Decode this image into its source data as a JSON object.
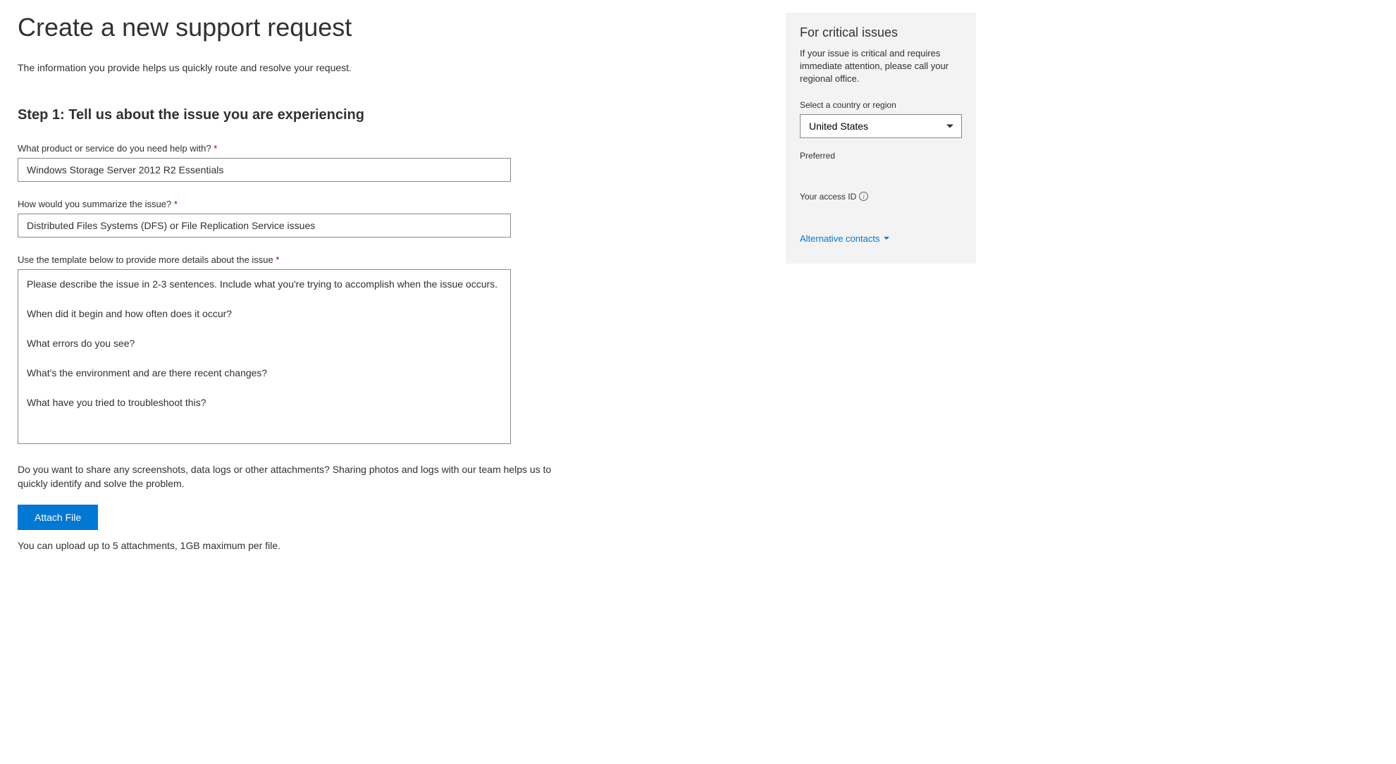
{
  "page": {
    "title": "Create a new support request",
    "subtitle": "The information you provide helps us quickly route and resolve your request."
  },
  "step1": {
    "heading": "Step 1: Tell us about the issue you are experiencing",
    "product": {
      "label": "What product or service do you need help with? ",
      "value": "Windows Storage Server 2012 R2 Essentials"
    },
    "summary": {
      "label": "How would you summarize the issue? ",
      "value": "Distributed Files Systems (DFS) or File Replication Service issues"
    },
    "details": {
      "label": "Use the template below to provide more details about the issue ",
      "value": "Please describe the issue in 2-3 sentences. Include what you're trying to accomplish when the issue occurs.\n\nWhen did it begin and how often does it occur?\n\nWhat errors do you see?\n\nWhat's the environment and are there recent changes?\n\nWhat have you tried to troubleshoot this?"
    },
    "attachments": {
      "description": "Do you want to share any screenshots, data logs or other attachments? Sharing photos and logs with our team helps us to quickly identify and solve the problem.",
      "button_label": "Attach File",
      "help_text": "You can upload up to 5 attachments, 1GB maximum per file."
    }
  },
  "sidebar": {
    "heading": "For critical issues",
    "description": "If your issue is critical and requires immediate attention, please call your regional office.",
    "country_label": "Select a country or region",
    "country_value": "United States",
    "preferred_label": "Preferred",
    "preferred_value": "",
    "access_id_label": "Your access ID",
    "access_id_value": "",
    "alternative_contacts_label": "Alternative contacts"
  }
}
